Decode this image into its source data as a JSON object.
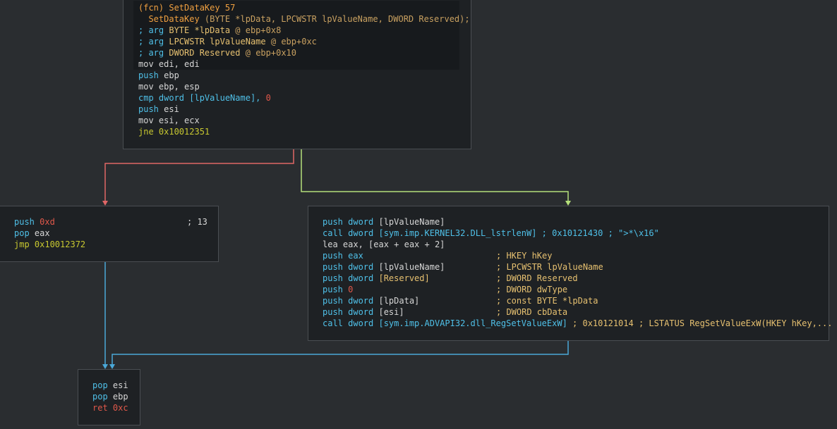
{
  "graph": {
    "nodes": {
      "entry": {
        "header": {
          "fcn_tag": "(fcn)",
          "fcn_name": "SetDataKey",
          "fcn_size": "57"
        },
        "signature": {
          "name": "SetDataKey",
          "params": " (BYTE *lpData, LPCWSTR lpValueName, DWORD Reserved);"
        },
        "args": [
          {
            "prefix": "; arg ",
            "type": "BYTE *lpData",
            "loc": " @ ebp+0x8"
          },
          {
            "prefix": "; arg ",
            "type": "LPCWSTR lpValueName",
            "loc": " @ ebp+0xc"
          },
          {
            "prefix": "; arg ",
            "type": "DWORD Reserved",
            "loc": " @ ebp+0x10"
          }
        ],
        "code": [
          {
            "mnem": "mov",
            "ops": " edi, edi"
          },
          {
            "mnem": "push",
            "ops": " ebp"
          },
          {
            "mnem": "mov",
            "ops": " ebp, esp"
          },
          {
            "mnem": "cmp",
            "ops_a": " dword [lpValueName], ",
            "ops_b": "0"
          },
          {
            "mnem": "push",
            "ops": " esi"
          },
          {
            "mnem": "mov",
            "ops": " esi, ecx"
          },
          {
            "mnem": "jne",
            "ops": " 0x10012351"
          }
        ]
      },
      "left": {
        "code": [
          {
            "mnem": "push",
            "imm": " 0xd",
            "comment": "; 13"
          },
          {
            "mnem": "pop",
            "ops": " eax"
          },
          {
            "mnem": "jmp",
            "ops": " 0x10012372"
          }
        ]
      },
      "right": {
        "code": [
          {
            "a": "push dword ",
            "b": "[lpValueName]",
            "c": "",
            "d": ""
          },
          {
            "a": "call dword ",
            "b": "[sym.imp.KERNEL32.DLL_lstrlenW]",
            "c": " ; 0x10121430 ; \">*\\x16\"",
            "d": ""
          },
          {
            "a": "lea eax, [eax + eax + 2]",
            "b": "",
            "c": "",
            "d": ""
          },
          {
            "a": "push eax",
            "b": "",
            "c": "",
            "d": "; HKEY hKey"
          },
          {
            "a": "push dword ",
            "b": "[lpValueName]",
            "c": "",
            "d": "; LPCWSTR lpValueName"
          },
          {
            "a": "push dword ",
            "b": "[Reserved]",
            "c": "",
            "d": "; DWORD Reserved"
          },
          {
            "a": "push ",
            "b": "0",
            "c": "",
            "d": "; DWORD dwType"
          },
          {
            "a": "push dword ",
            "b": "[lpData]",
            "c": "",
            "d": "; const BYTE *lpData"
          },
          {
            "a": "push dword ",
            "b": "[esi]",
            "c": "",
            "d": "; DWORD cbData"
          },
          {
            "a": "call dword ",
            "b": "[sym.imp.ADVAPI32.dll_RegSetValueExW]",
            "c": " ; 0x10121014 ; LSTATUS RegSetValueExW(HKEY hKey,...",
            "d": ""
          }
        ]
      },
      "exit": {
        "code": [
          {
            "mnem": "pop",
            "ops": " esi"
          },
          {
            "mnem": "pop",
            "ops": " ebp"
          },
          {
            "mnem": "ret",
            "ops": " 0xc"
          }
        ]
      }
    },
    "colors": {
      "edge_false": "#e06666",
      "edge_true": "#b5e07a",
      "edge_uncond": "#4aa8d8",
      "node_bg": "#1e2124",
      "canvas_bg": "#2a2d30"
    }
  }
}
